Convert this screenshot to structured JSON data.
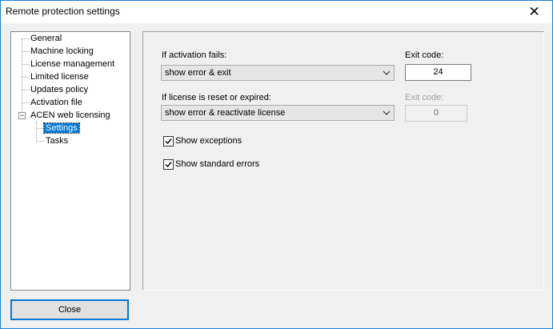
{
  "window": {
    "title": "Remote protection settings",
    "close_glyph": "✕"
  },
  "tree": {
    "items": [
      {
        "label": "General"
      },
      {
        "label": "Machine locking"
      },
      {
        "label": "License management"
      },
      {
        "label": "Limited license"
      },
      {
        "label": "Updates policy"
      },
      {
        "label": "Activation file"
      },
      {
        "label": "ACEN web licensing",
        "expanded": true,
        "expander_glyph": "−"
      },
      {
        "label": "Settings",
        "selected": true
      },
      {
        "label": "Tasks"
      }
    ]
  },
  "panel": {
    "activation_fails_label": "If activation fails:",
    "activation_fails_value": "show error & exit",
    "exit_code_label": "Exit code:",
    "exit_code_value": "24",
    "reset_label": "If license is reset or expired:",
    "reset_value": "show error & reactivate license",
    "exit_code2_label": "Exit code:",
    "exit_code2_value": "0",
    "show_exceptions_label": "Show exceptions",
    "show_exceptions_checked": true,
    "show_std_errors_label": "Show standard errors",
    "show_std_errors_checked": true
  },
  "buttons": {
    "close_label": "Close"
  },
  "colors": {
    "accent": "#0078d7",
    "window_border": "#1883d7",
    "face": "#f0f0f0"
  },
  "icons": {
    "dropdown": "chevron-down-icon",
    "check": "checkmark-icon",
    "close": "close-icon"
  }
}
